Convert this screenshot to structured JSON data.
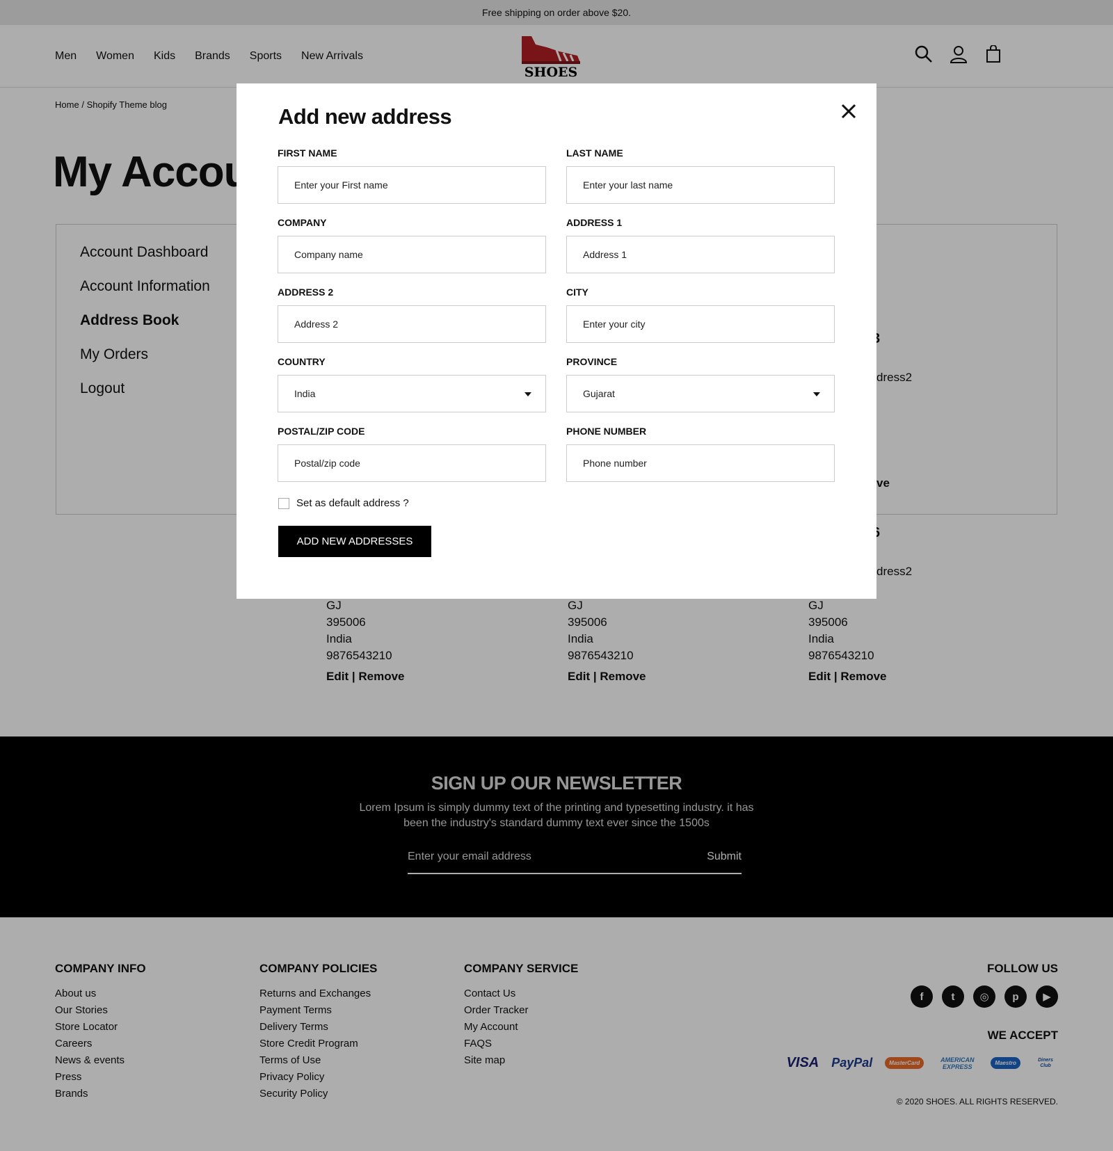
{
  "topbar": {
    "text": "Free shipping on order above $20."
  },
  "nav": {
    "items": [
      "Men",
      "Women",
      "Kids",
      "Brands",
      "Sports",
      "New Arrivals"
    ]
  },
  "logo": {
    "text": "SHOES",
    "color": "#b32024"
  },
  "header_icons": [
    "search-icon",
    "user-icon",
    "cart-icon"
  ],
  "breadcrumb": {
    "home": "Home",
    "sep": "/",
    "current": "Shopify Theme blog"
  },
  "page": {
    "title": "My Accou"
  },
  "sidebar": {
    "items": [
      {
        "label": "Account Dashboard"
      },
      {
        "label": "Account Information"
      },
      {
        "label": "Address Book"
      },
      {
        "label": "My Orders"
      },
      {
        "label": "Logout"
      }
    ]
  },
  "address_fragments": {
    "num_a": "3",
    "line_a": "dress2",
    "remove_a": "ve",
    "num_b": "6",
    "line_b": "dress2"
  },
  "addresses": [
    {
      "state": "GJ",
      "zip": "395006",
      "country": "India",
      "phone": "9876543210",
      "edit": "Edit",
      "sep": "|",
      "remove": "Remove"
    },
    {
      "state": "GJ",
      "zip": "395006",
      "country": "India",
      "phone": "9876543210",
      "edit": "Edit",
      "sep": "|",
      "remove": "Remove"
    },
    {
      "state": "GJ",
      "zip": "395006",
      "country": "India",
      "phone": "9876543210",
      "edit": "Edit",
      "sep": "|",
      "remove": "Remove"
    }
  ],
  "modal": {
    "title": "Add new address",
    "fields": {
      "first_name": {
        "label": "FIRST NAME",
        "placeholder": "Enter your First name"
      },
      "last_name": {
        "label": "LAST NAME",
        "placeholder": "Enter your last name"
      },
      "company": {
        "label": "COMPANY",
        "placeholder": "Company name"
      },
      "address1": {
        "label": "ADDRESS 1",
        "placeholder": "Address 1"
      },
      "address2": {
        "label": "ADDRESS 2",
        "placeholder": "Address 2"
      },
      "city": {
        "label": "CITY",
        "placeholder": "Enter your city"
      },
      "country": {
        "label": "COUNTRY",
        "value": "India"
      },
      "province": {
        "label": "PROVINCE",
        "value": "Gujarat"
      },
      "postal": {
        "label": "POSTAL/ZIP CODE",
        "placeholder": "Postal/zip code"
      },
      "phone": {
        "label": "PHONE NUMBER",
        "placeholder": "Phone number"
      }
    },
    "default_checkbox": "Set as default address ?",
    "submit": "ADD NEW ADDRESSES"
  },
  "newsletter": {
    "title": "SIGN UP OUR NEWSLETTER",
    "text": "Lorem Ipsum is simply dummy text of the printing and typesetting industry. it has been the industry's standard dummy text ever since the 1500s",
    "placeholder": "Enter your email address",
    "submit": "Submit"
  },
  "footer": {
    "company_info": {
      "title": "COMPANY INFO",
      "links": [
        "About us",
        "Our Stories",
        "Store Locator",
        "Careers",
        "News & events",
        "Press",
        "Brands"
      ]
    },
    "company_policies": {
      "title": "COMPANY POLICIES",
      "links": [
        "Returns and Exchanges",
        "Payment Terms",
        "Delivery Terms",
        "Store Credit Program",
        "Terms of Use",
        "Privacy Policy",
        "Security Policy"
      ]
    },
    "company_service": {
      "title": "COMPANY SERVICE",
      "links": [
        "Contact Us",
        "Order Tracker",
        "My Account",
        "FAQS",
        "Site map"
      ]
    },
    "follow_us": "FOLLOW US",
    "socials": [
      "facebook-icon",
      "twitter-icon",
      "instagram-icon",
      "pinterest-icon",
      "youtube-icon"
    ],
    "we_accept": "WE ACCEPT",
    "payment_cards": [
      "VISA",
      "PayPal",
      "MasterCard",
      "AMERICAN EXPRESS",
      "Maestro",
      "Diners Club"
    ],
    "copyright": "© 2020 SHOES. ALL RIGHTS RESERVED."
  }
}
